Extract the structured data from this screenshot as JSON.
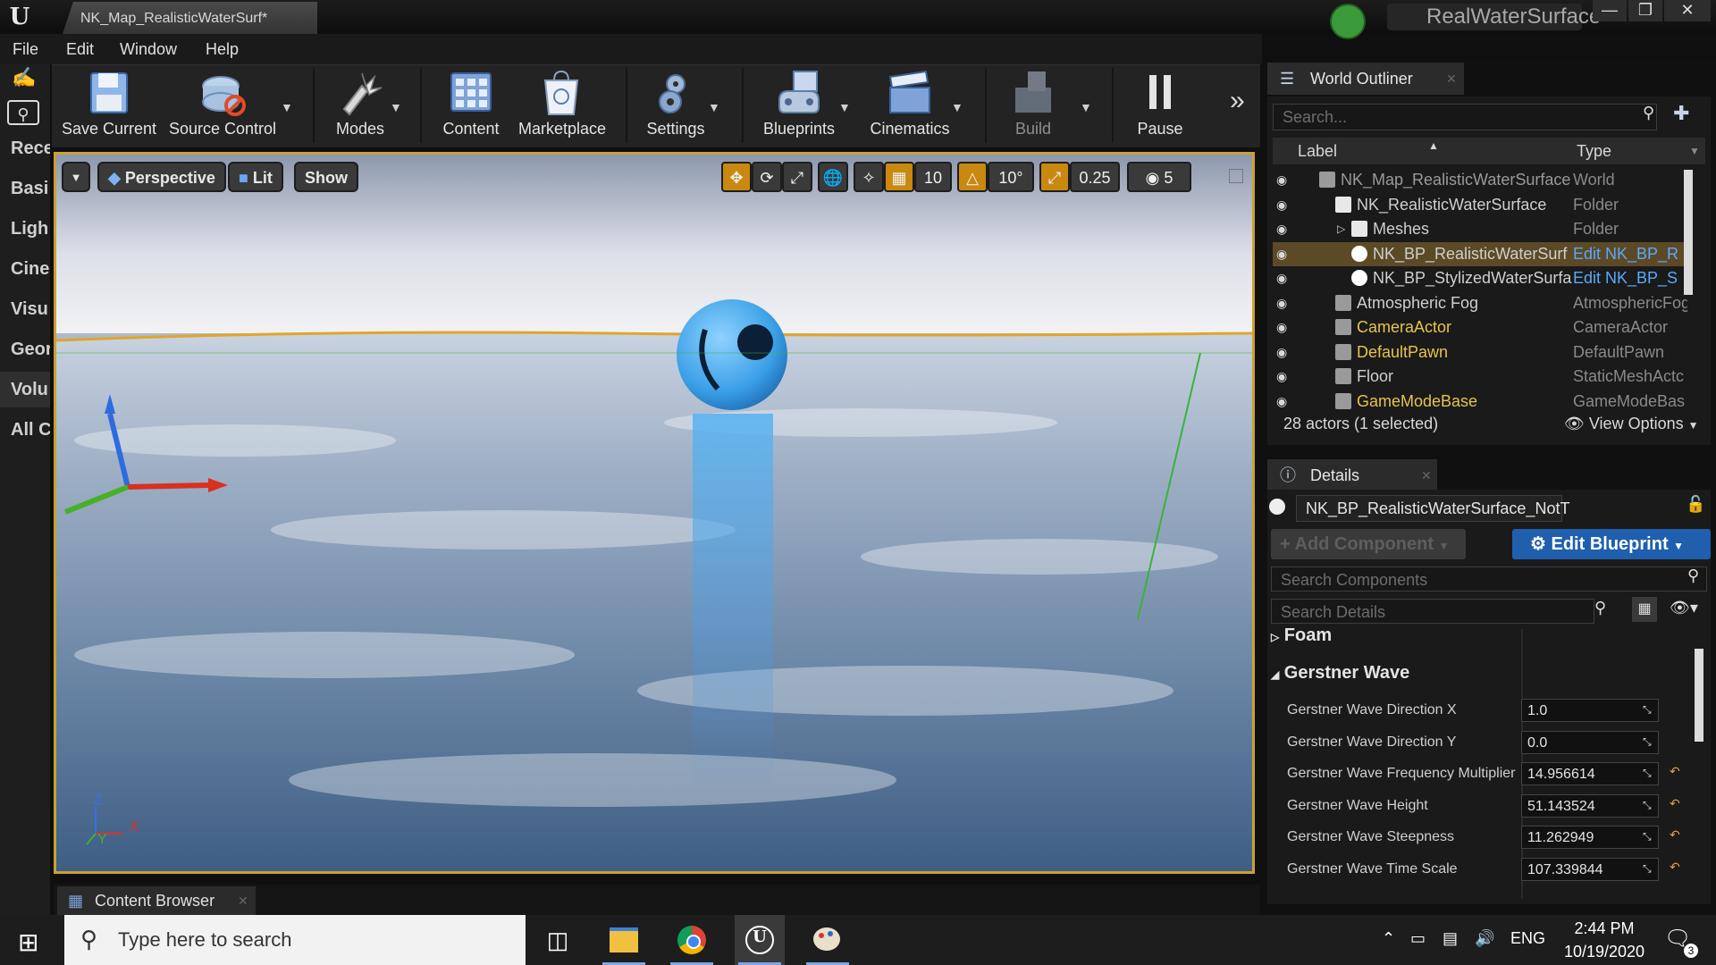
{
  "window": {
    "tab_title": "NK_Map_RealisticWaterSurf*",
    "app_title": "RealWaterSurface"
  },
  "menu": [
    "File",
    "Edit",
    "Window",
    "Help"
  ],
  "left_panel": {
    "categories": [
      "Rece",
      "Basi",
      "Ligh",
      "Cine",
      "Visu",
      "Geor",
      "Volu",
      "All C"
    ]
  },
  "toolbar": {
    "buttons": [
      {
        "label": "Save Current",
        "icon": "save-icon"
      },
      {
        "label": "Source Control",
        "icon": "source-control-icon"
      },
      {
        "label": "Modes",
        "icon": "modes-icon"
      },
      {
        "label": "Content",
        "icon": "content-icon"
      },
      {
        "label": "Marketplace",
        "icon": "marketplace-icon"
      },
      {
        "label": "Settings",
        "icon": "settings-icon"
      },
      {
        "label": "Blueprints",
        "icon": "blueprints-icon"
      },
      {
        "label": "Cinematics",
        "icon": "cinematics-icon"
      },
      {
        "label": "Build",
        "icon": "build-icon"
      },
      {
        "label": "Pause",
        "icon": "pause-icon"
      }
    ]
  },
  "viewport": {
    "perspective_label": "Perspective",
    "lit_label": "Lit",
    "show_label": "Show",
    "grid_snap": "10",
    "rotation_snap": "10°",
    "scale_snap": "0.25",
    "camera_speed": "5",
    "axis_z": "Z",
    "axis_y": "Y",
    "axis_x": "X"
  },
  "content_browser": {
    "tab_label": "Content Browser"
  },
  "world_outliner": {
    "tab_label": "World Outliner",
    "search_placeholder": "Search...",
    "col_label": "Label",
    "col_type": "Type",
    "rows": [
      {
        "label": "NK_Map_RealisticWaterSurface",
        "type": "World",
        "indent": 0,
        "style": "grey"
      },
      {
        "label": "NK_RealisticWaterSurface",
        "type": "Folder",
        "indent": 1,
        "style": "normal"
      },
      {
        "label": "Meshes",
        "type": "Folder",
        "indent": 2,
        "style": "normal"
      },
      {
        "label": "NK_BP_RealisticWaterSurf",
        "type": "Edit NK_BP_R",
        "indent": 2,
        "style": "normal",
        "selected": true
      },
      {
        "label": "NK_BP_StylizedWaterSurfa",
        "type": "Edit NK_BP_S",
        "indent": 2,
        "style": "normal"
      },
      {
        "label": "Atmospheric Fog",
        "type": "AtmosphericFog",
        "indent": 1,
        "style": "normal"
      },
      {
        "label": "CameraActor",
        "type": "CameraActor",
        "indent": 1,
        "style": "yellow"
      },
      {
        "label": "DefaultPawn",
        "type": "DefaultPawn",
        "indent": 1,
        "style": "yellow"
      },
      {
        "label": "Floor",
        "type": "StaticMeshActc",
        "indent": 1,
        "style": "normal"
      },
      {
        "label": "GameModeBase",
        "type": "GameModeBas",
        "indent": 1,
        "style": "yellow"
      }
    ],
    "footer_count": "28 actors (1 selected)",
    "view_options": "View Options"
  },
  "details": {
    "tab_label": "Details",
    "object_name": "NK_BP_RealisticWaterSurface_NotT",
    "add_component": "+ Add Component",
    "edit_blueprint": "Edit Blueprint",
    "search_components": "Search Components",
    "search_details": "Search Details",
    "foam_section": "Foam",
    "gerstner_section": "Gerstner Wave",
    "properties": [
      {
        "label": "Gerstner Wave Direction X",
        "value": "1.0",
        "reset": false
      },
      {
        "label": "Gerstner Wave Direction Y",
        "value": "0.0",
        "reset": false
      },
      {
        "label": "Gerstner Wave Frequency Multiplier",
        "value": "14.956614",
        "reset": true
      },
      {
        "label": "Gerstner Wave Height",
        "value": "51.143524",
        "reset": true
      },
      {
        "label": "Gerstner Wave Steepness",
        "value": "11.262949",
        "reset": true
      },
      {
        "label": "Gerstner Wave Time Scale",
        "value": "107.339844",
        "reset": true
      }
    ]
  },
  "taskbar": {
    "search_placeholder": "Type here to search",
    "language": "ENG",
    "time": "2:44 PM",
    "date": "10/19/2020",
    "notification_count": "3"
  },
  "colors": {
    "viewport_border": "#caa133",
    "selection": "#5c4a26",
    "link": "#5aa9ff",
    "actor_yellow": "#e6c44a",
    "edit_blueprint_bg": "#1f5fae"
  }
}
